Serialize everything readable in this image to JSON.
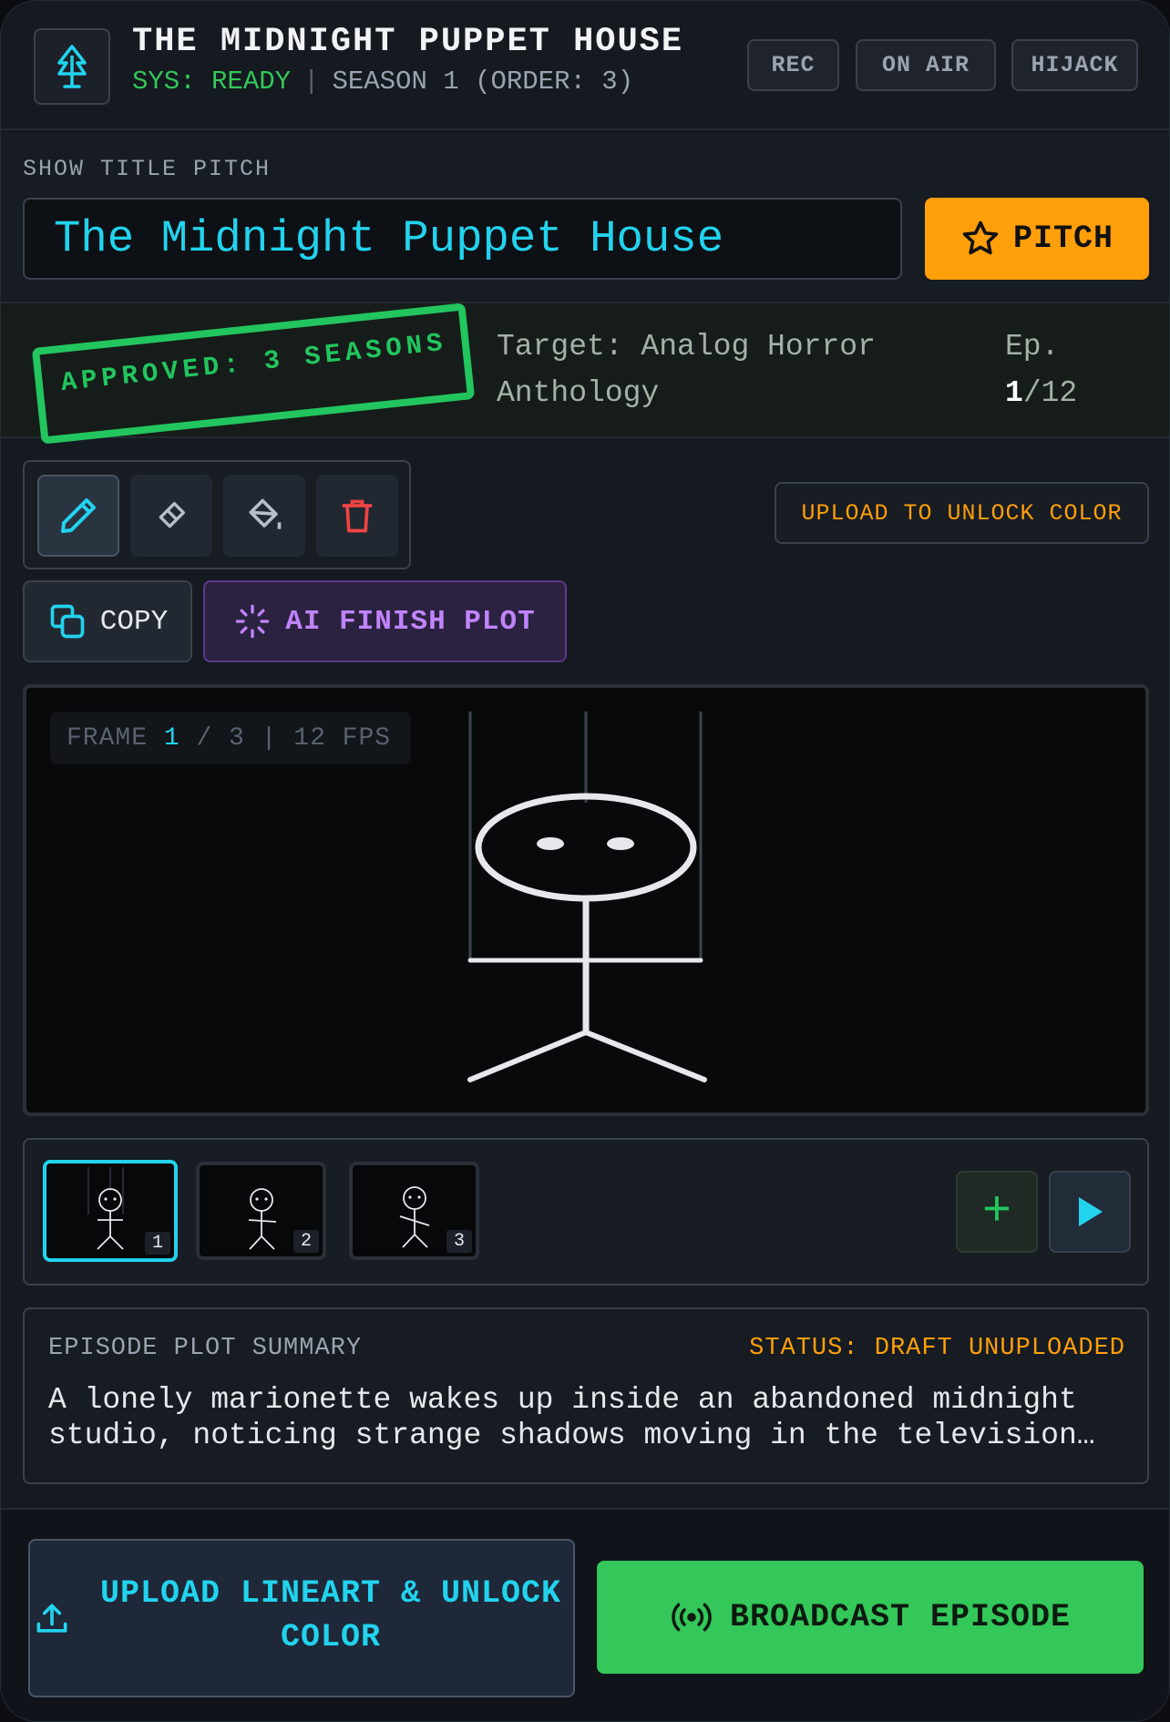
{
  "header": {
    "title": "THE MIDNIGHT PUPPET HOUSE",
    "sys_status": "SYS: READY",
    "separator": "|",
    "season_info": "SEASON 1 (ORDER: 3)",
    "buttons": [
      "REC",
      "ON AIR",
      "HIJACK"
    ]
  },
  "pitch": {
    "label": "SHOW TITLE PITCH",
    "title_value": "The Midnight Puppet House",
    "button_label": "PITCH"
  },
  "approval": {
    "stamp": "APPROVED: 3 SEASONS",
    "target": "Target: Analog Horror Anthology",
    "ep_label": "Ep.",
    "ep_current": "1",
    "ep_total": "/12"
  },
  "tools": {
    "items": [
      "pencil-icon",
      "eraser-icon",
      "fill-bucket-icon",
      "trash-icon"
    ],
    "unlock_label": "UPLOAD TO UNLOCK COLOR",
    "copy_label": "COPY",
    "ai_label": "AI FINISH PLOT"
  },
  "canvas": {
    "frame_prefix": "FRAME",
    "frame_current": "1",
    "frame_suffix": "/ 3 | 12 FPS"
  },
  "filmstrip": {
    "frames": [
      "1",
      "2",
      "3"
    ],
    "add_label": "+"
  },
  "summary": {
    "label": "EPISODE PLOT SUMMARY",
    "status": "STATUS: DRAFT UNUPLOADED",
    "text": "A lonely marionette wakes up inside an abandoned midnight studio, noticing strange shadows moving in the television…"
  },
  "footer": {
    "upload_label": "UPLOAD LINEART & UNLOCK COLOR",
    "broadcast_label": "BROADCAST EPISODE"
  },
  "colors": {
    "accent_cyan": "#22d3ee",
    "accent_orange": "#ff9f0a",
    "accent_green": "#34c759",
    "accent_purple": "#c084fc",
    "danger_red": "#ef4444"
  }
}
